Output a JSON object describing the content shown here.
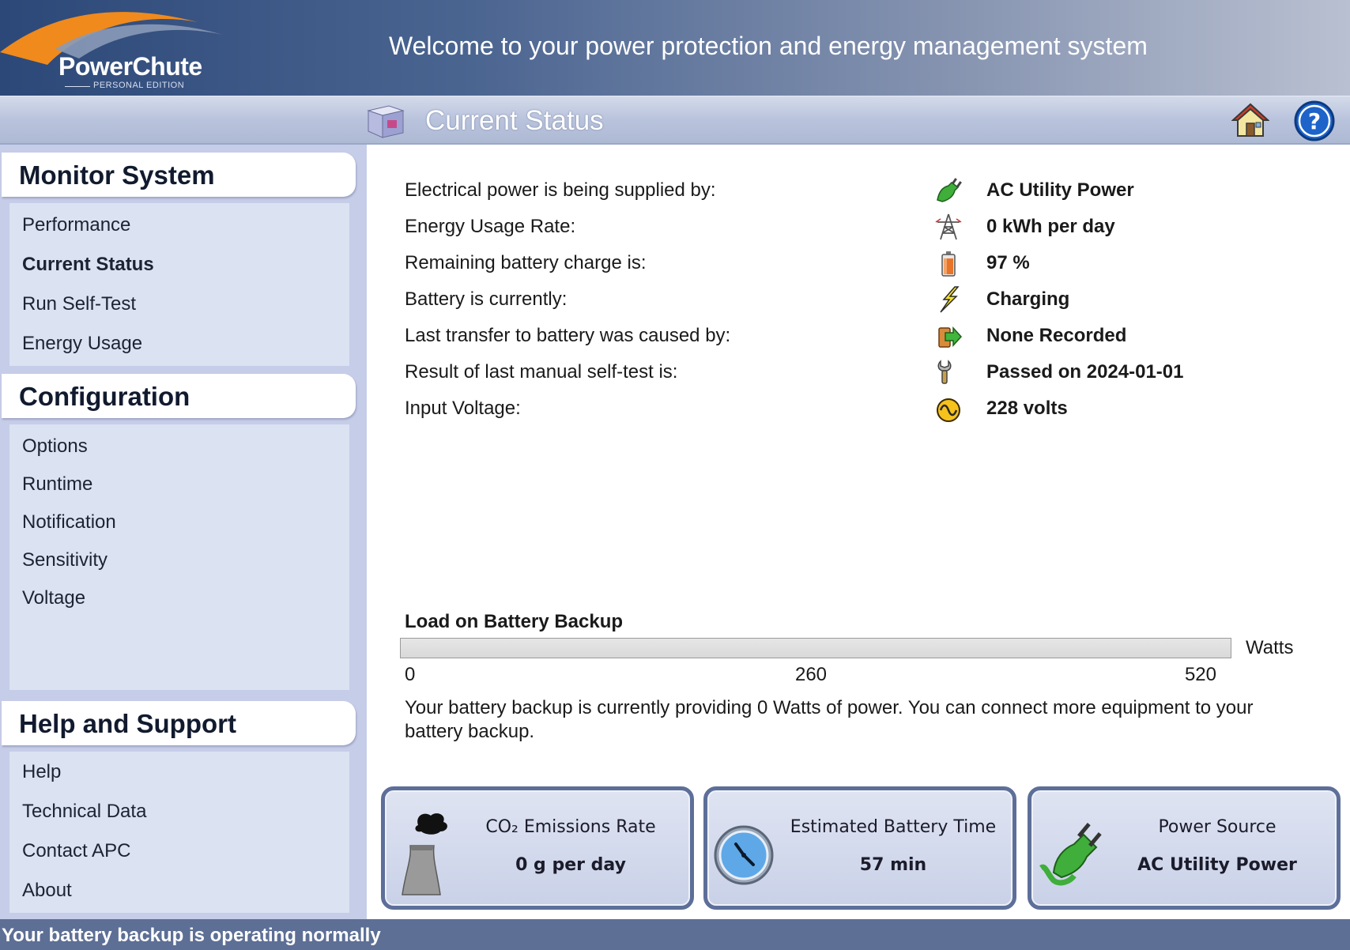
{
  "header": {
    "logo_text": "PowerChute",
    "logo_edition": "PERSONAL EDITION",
    "welcome": "Welcome to your power protection and energy management system"
  },
  "titlebar": {
    "title": "Current Status",
    "home_icon": "home-icon",
    "help_icon": "help-icon"
  },
  "sidebar": {
    "sections": [
      {
        "title": "Monitor System",
        "items": [
          "Performance",
          "Current Status",
          "Run Self-Test",
          "Energy Usage"
        ],
        "active": "Current Status"
      },
      {
        "title": "Configuration",
        "items": [
          "Options",
          "Runtime",
          "Notification",
          "Sensitivity",
          "Voltage"
        ]
      },
      {
        "title": "Help and Support",
        "items": [
          "Help",
          "Technical Data",
          "Contact APC",
          "About"
        ]
      }
    ]
  },
  "status": [
    {
      "label": "Electrical power is being supplied by:",
      "value": "AC Utility Power",
      "icon": "power-plug-icon"
    },
    {
      "label": "Energy Usage Rate:",
      "value": "0 kWh per day",
      "icon": "power-tower-icon"
    },
    {
      "label": "Remaining battery charge is:",
      "value": "97 %",
      "icon": "battery-icon"
    },
    {
      "label": "Battery is currently:",
      "value": "Charging",
      "icon": "lightning-icon"
    },
    {
      "label": "Last transfer to battery was caused by:",
      "value": "None Recorded",
      "icon": "transfer-icon"
    },
    {
      "label": "Result of last manual self-test is:",
      "value": "Passed on 2024-01-01",
      "icon": "wrench-icon"
    },
    {
      "label": "Input Voltage:",
      "value": "228 volts",
      "icon": "voltage-icon"
    }
  ],
  "load": {
    "title": "Load on Battery Backup",
    "unit": "Watts",
    "ticks": [
      "0",
      "260",
      "520"
    ],
    "current_watts": 0,
    "max_watts": 520,
    "message": "Your battery backup is currently providing 0 Watts of power. You can connect more equipment to your battery backup."
  },
  "cards": [
    {
      "label": "CO₂ Emissions Rate",
      "value": "0 g per day",
      "icon": "smokestack-icon"
    },
    {
      "label": "Estimated Battery Time",
      "value": "57 min",
      "icon": "clock-icon"
    },
    {
      "label": "Power Source",
      "value": "AC Utility Power",
      "icon": "power-plug-icon"
    }
  ],
  "footer": {
    "status": "Your battery backup is operating normally"
  },
  "colors": {
    "accent": "#2c4878",
    "sidebar": "#c6cde8",
    "footer": "#5d6f95",
    "logo_arc": "#f08a1c"
  }
}
